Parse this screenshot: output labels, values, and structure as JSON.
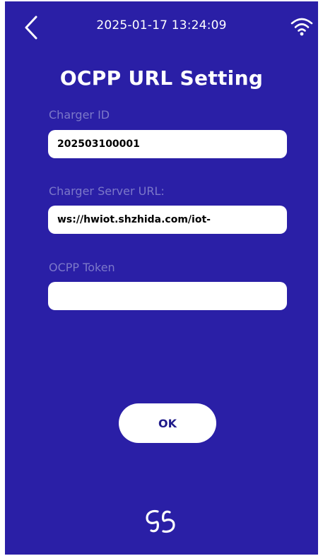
{
  "status_bar": {
    "datetime": "2025-01-17 13:24:09",
    "back_icon": "chevron-left-icon",
    "wifi_icon": "wifi-icon"
  },
  "page": {
    "title": "OCPP URL Setting"
  },
  "fields": {
    "charger_id": {
      "label": "Charger ID",
      "value": "202503100001"
    },
    "server_url": {
      "label": "Charger Server URL:",
      "value": "ws://hwiot.shzhida.com/iot-"
    },
    "ocpp_token": {
      "label": "OCPP Token",
      "value": ""
    }
  },
  "actions": {
    "ok_label": "OK"
  },
  "footer": {
    "logo_icon": "brand-logo-icon"
  },
  "colors": {
    "background": "#2a1fa6",
    "label": "#7c78c9",
    "field_bg": "#ffffff",
    "button_text": "#1f1a8a"
  }
}
